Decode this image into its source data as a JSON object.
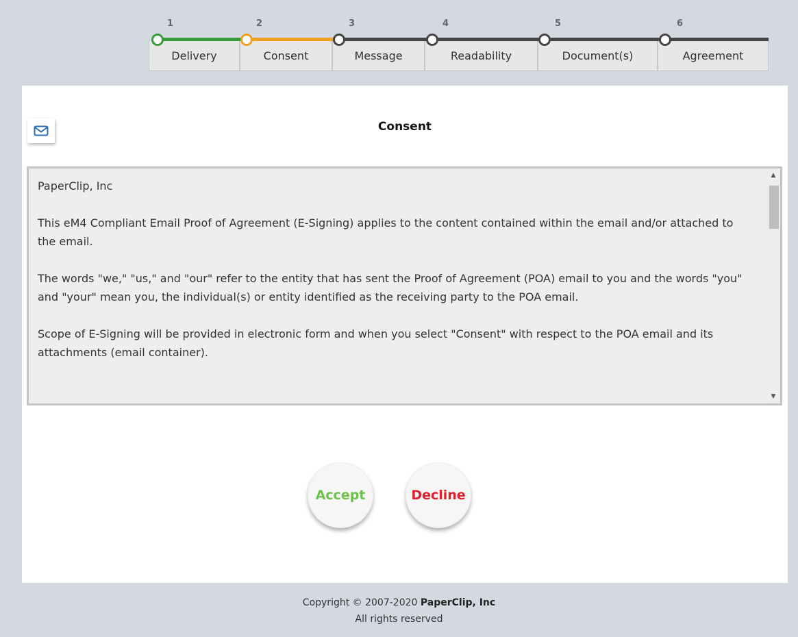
{
  "stepper": {
    "steps": [
      {
        "number": "1",
        "label": "Delivery",
        "state": "completed",
        "color": "#3a9a3a"
      },
      {
        "number": "2",
        "label": "Consent",
        "state": "current",
        "color": "#f0a020"
      },
      {
        "number": "3",
        "label": "Message",
        "state": "pending",
        "color": "#444444"
      },
      {
        "number": "4",
        "label": "Readability",
        "state": "pending",
        "color": "#444444"
      },
      {
        "number": "5",
        "label": "Document(s)",
        "state": "pending",
        "color": "#444444"
      },
      {
        "number": "6",
        "label": "Agreement",
        "state": "pending",
        "color": "#444444"
      }
    ]
  },
  "main": {
    "title": "Consent",
    "email_icon": "envelope-icon",
    "consent_text": [
      "PaperClip, Inc",
      "This eM4 Compliant Email Proof of Agreement (E-Signing) applies to the content contained within the email and/or attached to the email.",
      "The words \"we,\" \"us,\" and \"our\" refer to the entity that has sent the Proof of Agreement (POA) email to you and the words \"you\" and \"your\" mean you, the individual(s) or entity identified as the receiving party to the POA email.",
      "Scope of E-Signing will be provided in electronic form and when you select \"Consent\" with respect to the POA email and its attachments (email container)."
    ],
    "accept_label": "Accept",
    "decline_label": "Decline"
  },
  "footer": {
    "copyright_prefix": "Copyright © 2007-2020",
    "company": "PaperClip, Inc",
    "rights": "All rights reserved"
  },
  "colors": {
    "page_background": "#d3d8e1",
    "accept": "#6cc24a",
    "decline": "#e0202e"
  }
}
